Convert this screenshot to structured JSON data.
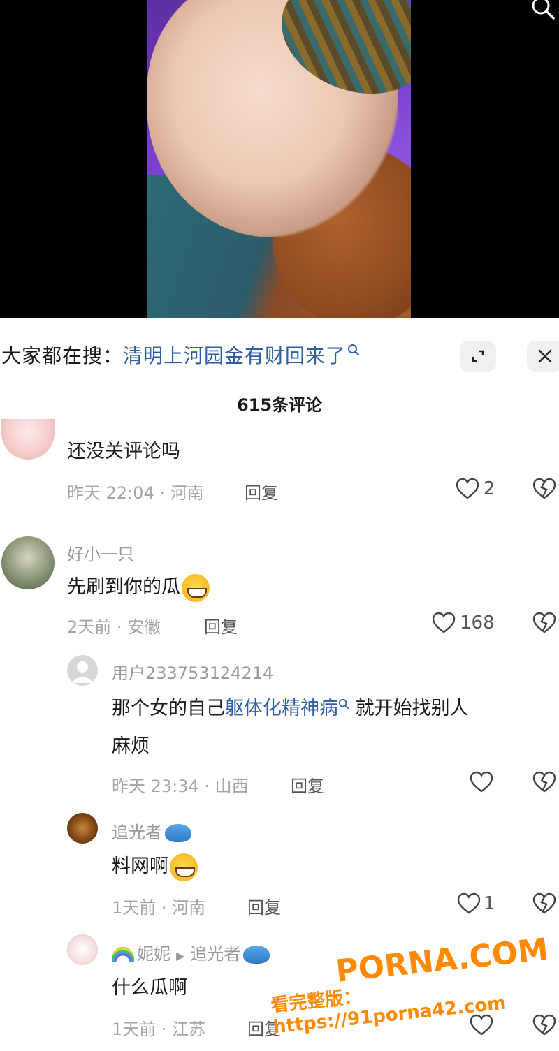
{
  "search": {
    "prefix": "大家都在搜：",
    "term": "清明上河园金有财回来了"
  },
  "comments_header": {
    "count_label": "615条评论"
  },
  "comments": [
    {
      "username": "",
      "text": "还没关评论吗",
      "time_location": "昨天 22:04 · 河南",
      "reply_label": "回复",
      "likes": "2"
    },
    {
      "username": "好小一只",
      "text": "先刷到你的瓜",
      "time_location": "2天前 · 安徽",
      "reply_label": "回复",
      "likes": "168"
    }
  ],
  "replies": [
    {
      "username": "用户233753124214",
      "text_before": "那个女的自己",
      "link": "躯体化精神病",
      "text_after": " 就开始找别人",
      "text_line2": "麻烦",
      "time_location": "昨天 23:34 · 山西",
      "reply_label": "回复",
      "likes": ""
    },
    {
      "username": "追光者",
      "text": "料网啊",
      "time_location": "1天前 · 河南",
      "reply_label": "回复",
      "likes": "1"
    },
    {
      "username": "妮妮",
      "reply_to": "追光者",
      "text": "什么瓜啊",
      "time_location": "1天前 · 江苏",
      "reply_label": "回复",
      "likes": ""
    }
  ],
  "watermark": {
    "logo": "PORNA.COM",
    "url": "看完整版：https://91porna42.com"
  },
  "colors": {
    "link": "#2e5fa6",
    "watermark": "#ff8a00"
  }
}
